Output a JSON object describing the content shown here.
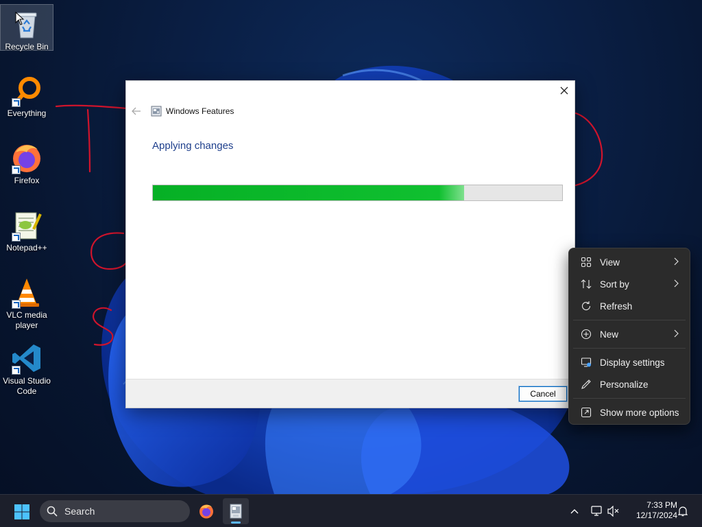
{
  "desktop": {
    "icons": [
      {
        "label": "Recycle Bin"
      },
      {
        "label": "Everything"
      },
      {
        "label": "Firefox"
      },
      {
        "label": "Notepad++"
      },
      {
        "label": "VLC media player"
      },
      {
        "label": "Visual Studio Code"
      }
    ]
  },
  "dialog": {
    "app_title": "Windows Features",
    "heading": "Applying changes",
    "progress_fraction": 0.76,
    "cancel_label": "Cancel"
  },
  "context_menu": {
    "items": [
      {
        "label": "View",
        "icon": "view-icon",
        "has_submenu": true
      },
      {
        "label": "Sort by",
        "icon": "sort-icon",
        "has_submenu": true
      },
      {
        "label": "Refresh",
        "icon": "refresh-icon",
        "has_submenu": false
      },
      {
        "label": "New",
        "icon": "new-icon",
        "has_submenu": true
      },
      {
        "label": "Display settings",
        "icon": "display-settings-icon",
        "has_submenu": false
      },
      {
        "label": "Personalize",
        "icon": "personalize-icon",
        "has_submenu": false
      },
      {
        "label": "Show more options",
        "icon": "show-more-options-icon",
        "has_submenu": false
      }
    ]
  },
  "taskbar": {
    "search_label": "Search",
    "clock_time": "7:33 PM",
    "clock_date": "12/17/2024"
  },
  "colors": {
    "progress_green": "#06b025",
    "dialog_heading": "#1e3f8c",
    "menu_background": "#2b2b2b",
    "taskbar_background": "#1c1f2b",
    "annotation_red": "#d0142c"
  }
}
